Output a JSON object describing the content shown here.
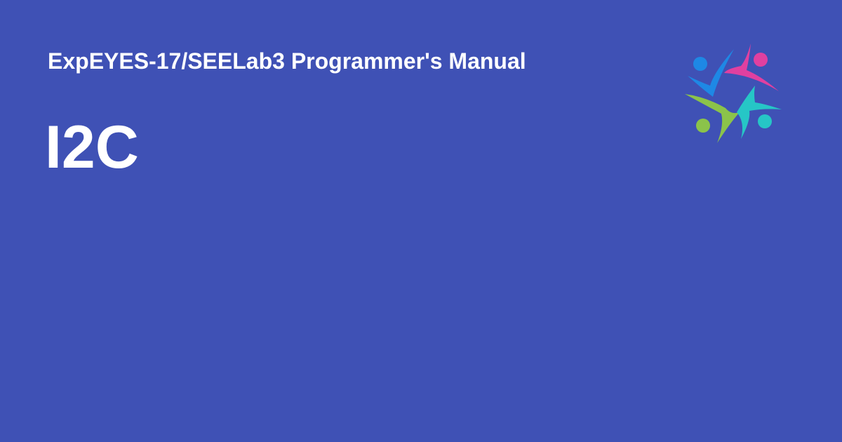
{
  "card": {
    "background_color": "#3f51b5",
    "text_color": "#ffffff",
    "site_title": "ExpEYES-17/SEELab3 Programmer's Manual",
    "page_title": "I2C"
  },
  "logo": {
    "icon": "people-circle-logo-icon",
    "colors": [
      "#1e88e5",
      "#e040a0",
      "#8bc34a",
      "#26c6c6"
    ]
  }
}
